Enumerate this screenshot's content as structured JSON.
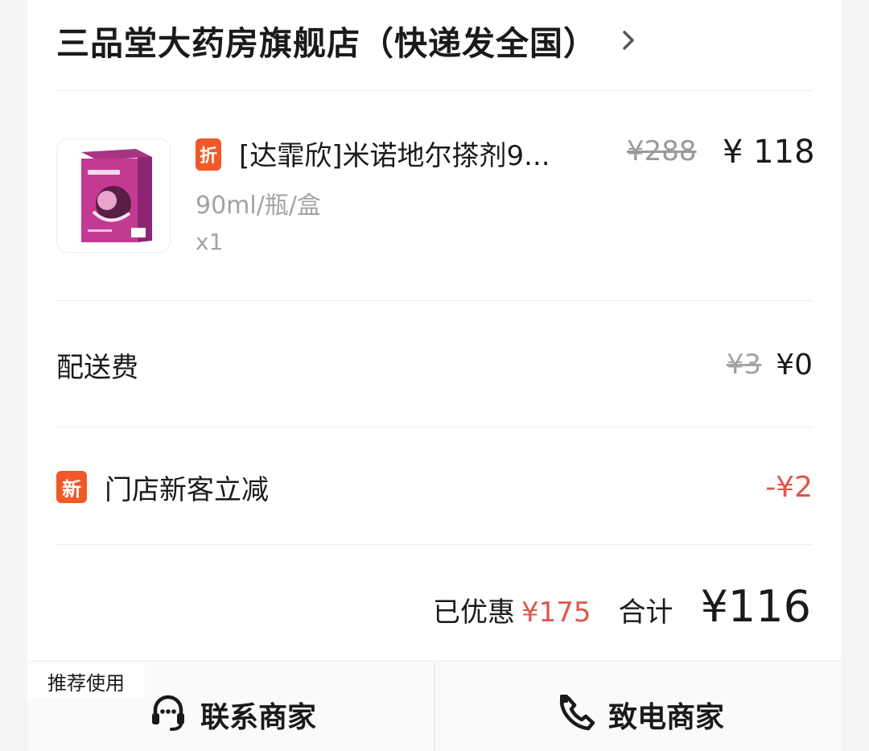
{
  "store": {
    "name": "三品堂大药房旗舰店（快递发全国）",
    "chevron_icon": "chevron-right-icon"
  },
  "product": {
    "discount_tag": "折",
    "name": "[达霏欣]米诺地尔搽剂9...",
    "original_price": "¥288",
    "price": "¥ 118",
    "spec": "90ml/瓶/盒",
    "quantity": "x1",
    "thumbnail_icon": "product-box-image"
  },
  "delivery": {
    "label": "配送费",
    "original": "¥3",
    "value": "¥0"
  },
  "new_customer": {
    "tag": "新",
    "label": "门店新客立减",
    "value": "-¥2"
  },
  "summary": {
    "saved_label": "已优惠",
    "saved_value": "¥175",
    "total_label": "合计",
    "total_value": "¥116"
  },
  "bottom_bar": {
    "recommend_label": "推荐使用",
    "contact_label": "联系商家",
    "contact_icon": "headset-icon",
    "call_label": "致电商家",
    "call_icon": "phone-icon"
  },
  "colors": {
    "accent": "#f05a28",
    "discount_red": "#e0564a",
    "muted": "#a3a3a3"
  }
}
